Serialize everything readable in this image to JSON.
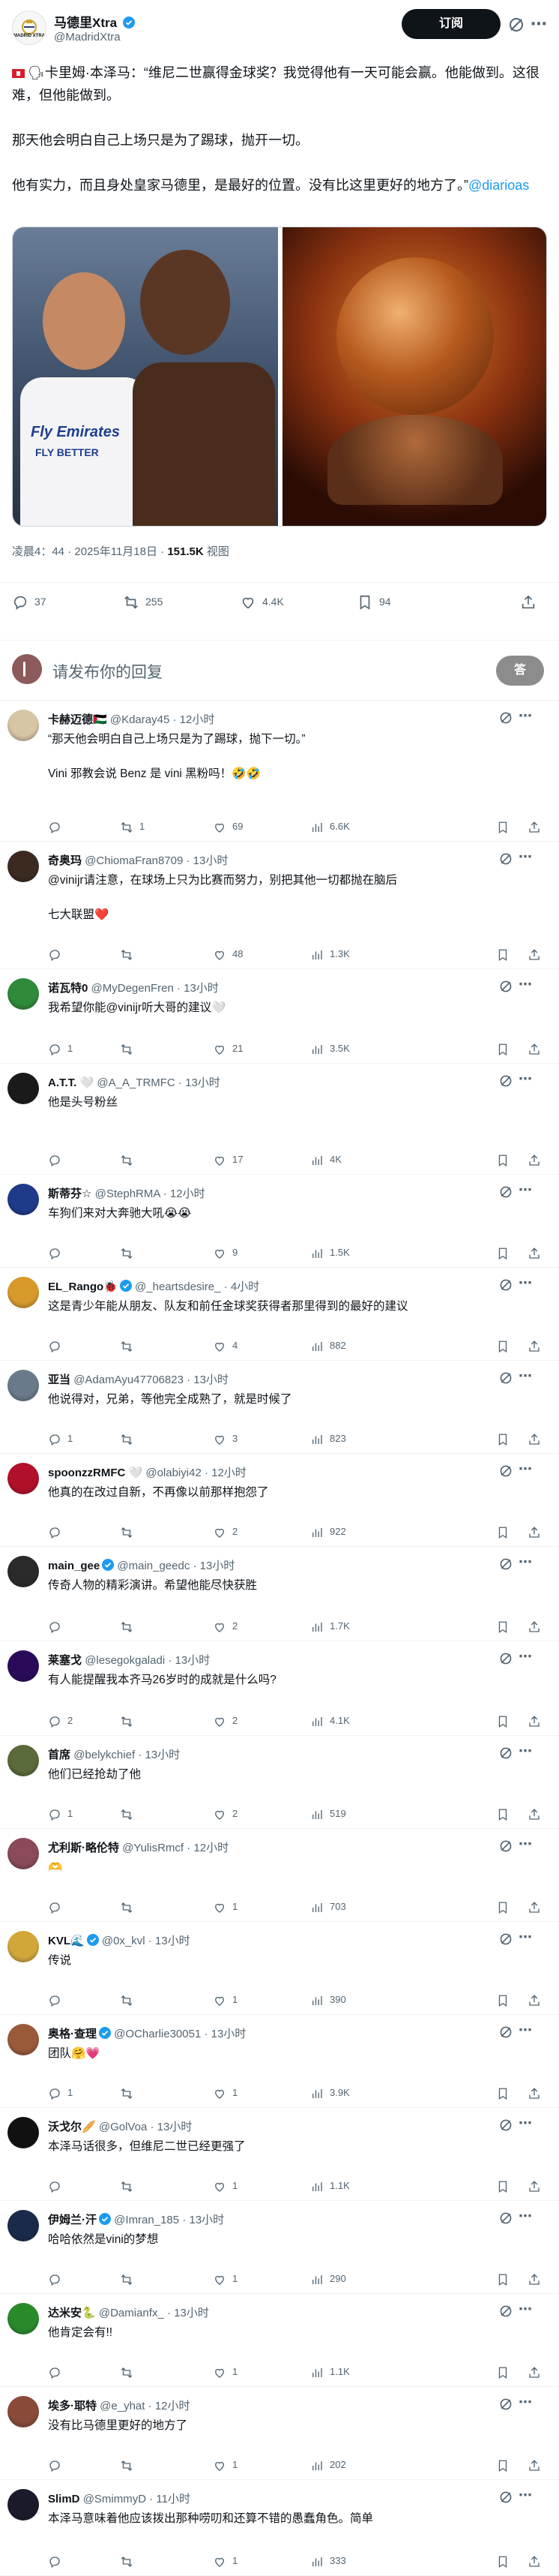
{
  "post": {
    "author_name": "马德里Xtra",
    "author_handle": "@MadridXtra",
    "avatar_text": "MADRID XTRA",
    "subscribe_label": "订阅",
    "text_line1": "🗣卡里姆·本泽马：“维尼二世赢得金球奖？我觉得他有一天可能会赢。他能做到。这很难，但他能做到。",
    "text_line2": "那天他会明白自己上场只是为了踢球，抛开一切。",
    "text_line3": "他有实力，而且身处皇家马德里，是最好的位置。没有比这里更好的地方了。”",
    "mention": "@diarioas",
    "timestamp": "凌晨4：44 · 2025年11月18日 · ",
    "views_count": "151.5K",
    "views_label": " 视图",
    "replies": "37",
    "reposts": "255",
    "likes": "4.4K",
    "bookmarks": "94",
    "image1_badge": "Fly Emirates",
    "image1_badge2": "FLY BETTER"
  },
  "reply_box": {
    "placeholder": "请发布你的回复",
    "button_label": "答"
  },
  "replies": [
    {
      "name": "卡赫迈德🇵🇸",
      "handle": "@Kdaray45 · 12小时",
      "text": "“那天他会明白自己上场只是为了踢球，抛下一切。”\n\nVini 邪教会说 Benz 是 vini 黑粉吗！🤣🤣",
      "r": "",
      "rt": "1",
      "l": "69",
      "v": "6.6K",
      "verified": false,
      "color": "#d7c6a6"
    },
    {
      "name": "奇奥玛",
      "handle": "@ChiomaFran8709 · 13小时",
      "text": "@vinijr请注意，在球场上只为比赛而努力，别把其他一切都抛在脑后\n\n七大联盟❤️",
      "r": "",
      "rt": "",
      "l": "48",
      "v": "1.3K",
      "verified": false,
      "color": "#3a2a20"
    },
    {
      "name": "诺瓦特0",
      "handle": "@MyDegenFren · 13小时",
      "text": "我希望你能@vinijr听大哥的建议🤍",
      "r": "1",
      "rt": "",
      "l": "21",
      "v": "3.5K",
      "verified": false,
      "color": "#2f8a3a"
    },
    {
      "name": "A.T.T.",
      "handle": "🤍 @A_A_TRMFC · 13小时",
      "text": "他是头号粉丝",
      "r": "",
      "rt": "",
      "l": "17",
      "v": "4K",
      "verified": false,
      "color": "#1a1a1a"
    },
    {
      "name": "斯蒂芬☆",
      "handle": "@StephRMA · 12小时",
      "text": "车狗们来对大奔驰大吼😭😭",
      "r": "",
      "rt": "",
      "l": "9",
      "v": "1.5K",
      "verified": false,
      "color": "#203a8a"
    },
    {
      "name": "EL_Rango🐞",
      "handle": "@_heartsdesire_ · 4小时",
      "text": "这是青少年能从朋友、队友和前任金球奖获得者那里得到的最好的建议",
      "r": "",
      "rt": "",
      "l": "4",
      "v": "882",
      "verified": true,
      "color": "#d79a2a"
    },
    {
      "name": "亚当",
      "handle": "@AdamAyu47706823 · 13小时",
      "text": "他说得对，兄弟，等他完全成熟了，就是时候了",
      "r": "1",
      "rt": "",
      "l": "3",
      "v": "823",
      "verified": false,
      "color": "#6a7a8a"
    },
    {
      "name": "spoonzzRMFC",
      "handle": "🤍 @olabiyi42 · 12小时",
      "text": "他真的在改过自新，不再像以前那样抱怨了",
      "r": "",
      "rt": "",
      "l": "2",
      "v": "922",
      "verified": false,
      "color": "#b2102a"
    },
    {
      "name": "main_gee",
      "handle": "@main_geedc · 13小时",
      "text": "传奇人物的精彩演讲。希望他能尽快获胜",
      "r": "",
      "rt": "",
      "l": "2",
      "v": "1.7K",
      "verified": true,
      "color": "#2a2a2a"
    },
    {
      "name": "莱塞戈",
      "handle": "@lesegokgaladi · 13小时",
      "text": "有人能提醒我本齐马26岁时的成就是什么吗?",
      "r": "2",
      "rt": "",
      "l": "2",
      "v": "4.1K",
      "verified": false,
      "color": "#2a0a5a"
    },
    {
      "name": "首席",
      "handle": "@belykchief · 13小时",
      "text": "他们已经抢劫了他",
      "r": "1",
      "rt": "",
      "l": "2",
      "v": "519",
      "verified": false,
      "color": "#5a6a3a"
    },
    {
      "name": "尤利斯·略伦特",
      "handle": "@YulisRmcf · 12小时",
      "text": "🫶",
      "r": "",
      "rt": "",
      "l": "1",
      "v": "703",
      "verified": false,
      "color": "#8a4a5a"
    },
    {
      "name": "KVL🌊",
      "handle": "@0x_kvl · 13小时",
      "text": "传说",
      "r": "",
      "rt": "",
      "l": "1",
      "v": "390",
      "verified": true,
      "color": "#d2a73a"
    },
    {
      "name": "奥格·查理",
      "handle": "@OCharlie30051 · 13小时",
      "text": "团队🤗💗",
      "r": "1",
      "rt": "",
      "l": "1",
      "v": "3.9K",
      "verified": true,
      "color": "#9a5a3a"
    },
    {
      "name": "沃戈尔🥖",
      "handle": "@GolVoa · 13小时",
      "text": "本泽马话很多，但维尼二世已经更强了",
      "r": "",
      "rt": "",
      "l": "1",
      "v": "1.1K",
      "verified": false,
      "color": "#111111"
    },
    {
      "name": "伊姆兰·汗",
      "handle": "@Imran_185 · 13小时",
      "text": "哈哈依然是vini的梦想",
      "r": "",
      "rt": "",
      "l": "1",
      "v": "290",
      "verified": true,
      "color": "#1a2a4a"
    },
    {
      "name": "达米安🐍",
      "handle": "@Damianfx_ · 13小时",
      "text": "他肯定会有!!",
      "r": "",
      "rt": "",
      "l": "1",
      "v": "1.1K",
      "verified": false,
      "color": "#2a8a2a"
    },
    {
      "name": "埃多·耶特",
      "handle": "@e_yhat · 12小时",
      "text": "没有比马德里更好的地方了",
      "r": "",
      "rt": "",
      "l": "1",
      "v": "202",
      "verified": false,
      "color": "#8a4a3a"
    },
    {
      "name": "SlimD",
      "handle": "@SmimmyD · 11小时",
      "text": "本泽马意味着他应该拨出那种唠叨和还算不错的愚蠢角色。简单",
      "r": "",
      "rt": "",
      "l": "1",
      "v": "333",
      "verified": false,
      "color": "#1a1a2a"
    }
  ]
}
